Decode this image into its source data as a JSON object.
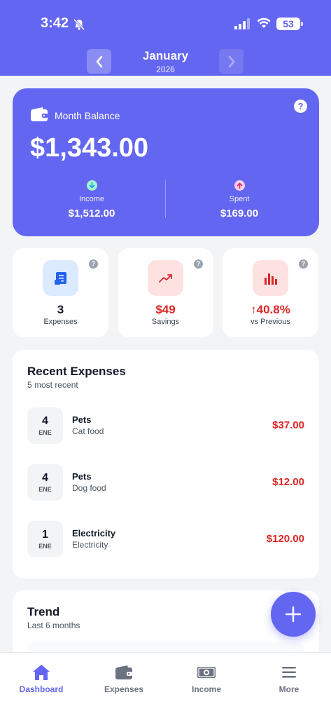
{
  "status": {
    "time": "3:42",
    "battery": "53"
  },
  "header": {
    "month": "January",
    "year": "2026"
  },
  "balance": {
    "label": "Month Balance",
    "amount": "$1,343.00",
    "income_label": "Income",
    "income_value": "$1,512.00",
    "spent_label": "Spent",
    "spent_value": "$169.00"
  },
  "stats": [
    {
      "value": "3",
      "label": "Expenses",
      "icon": "receipt-icon"
    },
    {
      "value": "$49",
      "label": "Savings",
      "icon": "trending-up-icon"
    },
    {
      "value": "↑40.8%",
      "label": "vs Previous",
      "icon": "bar-chart-icon"
    }
  ],
  "recent": {
    "title": "Recent Expenses",
    "subtitle": "5 most recent",
    "items": [
      {
        "day": "4",
        "month": "ENE",
        "category": "Pets",
        "description": "Cat food",
        "amount": "$37.00"
      },
      {
        "day": "4",
        "month": "ENE",
        "category": "Pets",
        "description": "Dog food",
        "amount": "$12.00"
      },
      {
        "day": "1",
        "month": "ENE",
        "category": "Electricity",
        "description": "Electricity",
        "amount": "$120.00"
      }
    ]
  },
  "trend": {
    "title": "Trend",
    "subtitle": "Last 6 months"
  },
  "tabs": [
    {
      "label": "Dashboard",
      "icon": "home-icon",
      "active": true
    },
    {
      "label": "Expenses",
      "icon": "wallet-icon",
      "active": false
    },
    {
      "label": "Income",
      "icon": "cash-icon",
      "active": false
    },
    {
      "label": "More",
      "icon": "menu-icon",
      "active": false
    }
  ],
  "colors": {
    "primary": "#6366f1",
    "danger": "#dc2626",
    "background": "#f3f4f6"
  }
}
